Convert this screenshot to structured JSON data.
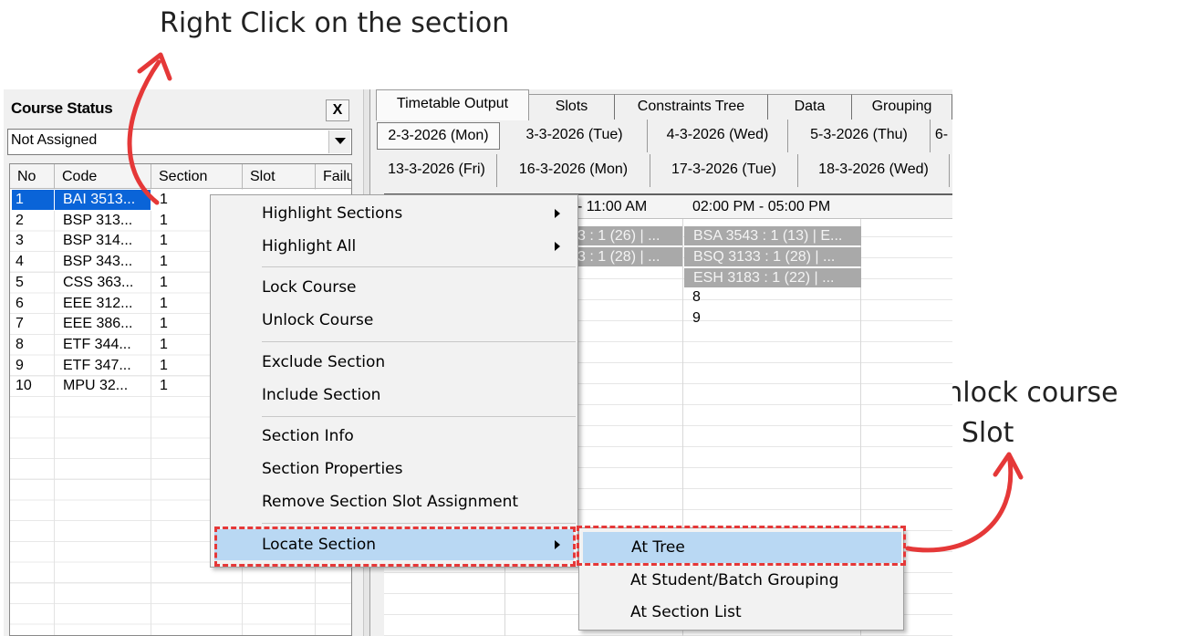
{
  "annotations": {
    "top": "Right Click on the section",
    "right_line1": "Choose Unlock course",
    "right_line2": "in Slot"
  },
  "colors": {
    "annotation_red": "#e53838",
    "selection_blue": "#0a64d8",
    "menu_highlight": "#b9d8f3"
  },
  "course_status": {
    "title": "Course Status",
    "close_label": "X",
    "filter_value": "Not Assigned",
    "columns": [
      "No",
      "Code",
      "Section",
      "Slot",
      "Failu"
    ],
    "rows": [
      {
        "no": "1",
        "code": "BAI 3513...",
        "section": "1"
      },
      {
        "no": "2",
        "code": "BSP 313...",
        "section": "1"
      },
      {
        "no": "3",
        "code": "BSP 314...",
        "section": "1"
      },
      {
        "no": "4",
        "code": "BSP 343...",
        "section": "1"
      },
      {
        "no": "5",
        "code": "CSS 363...",
        "section": "1"
      },
      {
        "no": "6",
        "code": "EEE 312...",
        "section": "1"
      },
      {
        "no": "7",
        "code": "EEE 386...",
        "section": "1"
      },
      {
        "no": "8",
        "code": "ETF 344...",
        "section": "1"
      },
      {
        "no": "9",
        "code": "ETF 347...",
        "section": "1"
      },
      {
        "no": "10",
        "code": "MPU 32...",
        "section": "1"
      }
    ]
  },
  "tabs": [
    "Timetable Output",
    "Slots",
    "Constraints Tree",
    "Data",
    "Grouping"
  ],
  "date_tabs_row1": [
    "2-3-2026 (Mon)",
    "3-3-2026 (Tue)",
    "4-3-2026 (Wed)",
    "5-3-2026 (Thu)",
    "6-"
  ],
  "date_tabs_row2": [
    "13-3-2026 (Fri)",
    "16-3-2026 (Mon)",
    "17-3-2026 (Tue)",
    "18-3-2026 (Wed)"
  ],
  "timetable": {
    "header_col2": "- 11:00 AM",
    "header_col3": "02:00 PM - 05:00 PM",
    "col2_cells": [
      "3 : 1 (26) | ...",
      "3 : 1 (28) | ..."
    ],
    "col3_cells": [
      "BSA 3543 : 1 (13) | E...",
      "BSQ 3133 : 1 (28) | ...",
      "ESH 3183 : 1 (22) | ..."
    ],
    "col3_plain": [
      "8",
      "9"
    ]
  },
  "context_menu": {
    "items": [
      "Highlight Sections",
      "Highlight All",
      "Lock Course",
      "Unlock Course",
      "Exclude Section",
      "Include Section",
      "Section Info",
      "Section Properties",
      "Remove Section Slot Assignment",
      "Locate Section"
    ]
  },
  "submenu": {
    "items": [
      "At Tree",
      "At Student/Batch Grouping",
      "At Section List"
    ]
  }
}
